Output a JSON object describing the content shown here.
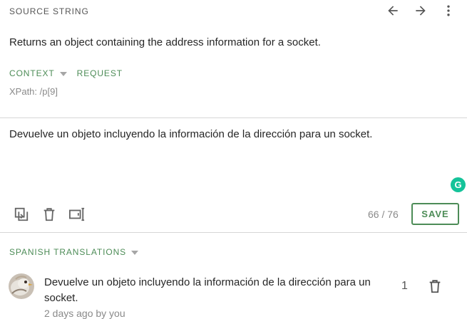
{
  "source": {
    "title": "SOURCE STRING",
    "text": "Returns an object containing the address information for a socket.",
    "context_label": "CONTEXT",
    "request_label": "REQUEST",
    "xpath": "XPath: /p[9]",
    "icons": {
      "prev": "arrow-left-icon",
      "next": "arrow-right-icon",
      "more": "more-vertical-icon"
    }
  },
  "editor": {
    "text": "Devuelve un objeto incluyendo la información de la dirección para un socket.",
    "grammarly_letter": "G",
    "counter": "66 / 76",
    "save_label": "SAVE",
    "tools": [
      "copy-source-icon",
      "delete-icon",
      "machine-translation-icon"
    ]
  },
  "translations": {
    "header": "SPANISH TRANSLATIONS",
    "items": [
      {
        "text": "Devuelve un objeto incluyendo la información de la dirección para un socket.",
        "meta": "2 days ago by you",
        "votes": "1"
      }
    ]
  },
  "colors": {
    "accent": "#4d8c57",
    "muted": "#8a8a8a",
    "grammarly": "#15c39a",
    "divider": "#d6d6d6"
  }
}
